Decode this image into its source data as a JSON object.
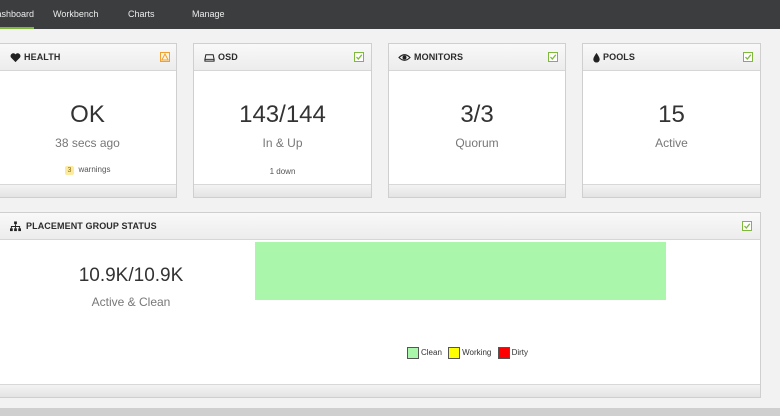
{
  "nav": {
    "items": [
      {
        "label": "Dashboard",
        "active": true
      },
      {
        "label": "Workbench"
      },
      {
        "label": "Charts"
      },
      {
        "label": "Manage"
      }
    ]
  },
  "health": {
    "title": "HEALTH",
    "value": "OK",
    "sub": "38 secs ago",
    "warnings_count": "3",
    "warnings_label": "warnings",
    "icon": "heart-icon",
    "status": "warning"
  },
  "osd": {
    "title": "OSD",
    "value": "143/144",
    "sub": "In & Up",
    "note": "1 down",
    "icon": "hdd-icon",
    "status": "ok"
  },
  "monitors": {
    "title": "MONITORS",
    "value": "3/3",
    "sub": "Quorum",
    "icon": "eye-icon",
    "status": "ok"
  },
  "pools": {
    "title": "POOLS",
    "value": "15",
    "sub": "Active",
    "icon": "droplet-icon",
    "status": "ok"
  },
  "pg": {
    "title": "PLACEMENT GROUP STATUS",
    "value": "10.9K/10.9K",
    "sub": "Active & Clean",
    "icon": "sitemap-icon",
    "status": "ok",
    "clean_fraction": 1.0,
    "legend": [
      {
        "label": "Clean",
        "color": "#aaf6aa"
      },
      {
        "label": "Working",
        "color": "#ffff00"
      },
      {
        "label": "Dirty",
        "color": "#ff0000"
      }
    ]
  },
  "colors": {
    "accent": "#7fb93c",
    "warning": "#f0a030",
    "topbar": "#3b3d3f"
  }
}
